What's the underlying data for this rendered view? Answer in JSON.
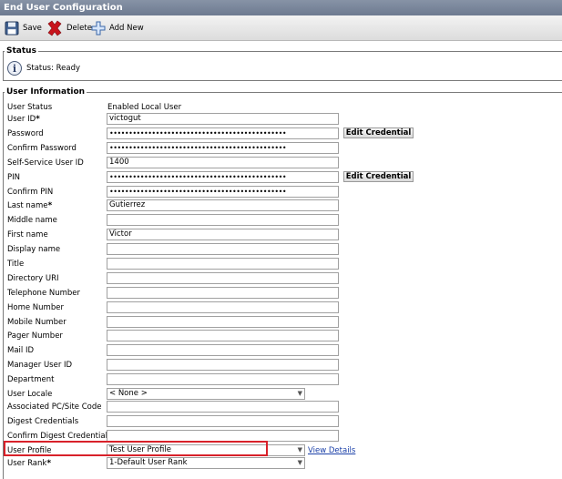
{
  "window": {
    "title": "End User Configuration"
  },
  "toolbar": {
    "save_label": "Save",
    "delete_label": "Delete",
    "add_new_label": "Add New"
  },
  "status": {
    "legend": "Status",
    "text": "Status: Ready"
  },
  "user_info": {
    "legend": "User Information",
    "user_status_label": "User Status",
    "user_status_value": "Enabled Local User",
    "user_id_label": "User ID",
    "user_id_value": "victogut",
    "password_label": "Password",
    "password_value": "••••••••••••••••••••••••••••••••••••••••••••••",
    "edit_credential_label": "Edit Credential",
    "confirm_password_label": "Confirm Password",
    "confirm_password_value": "••••••••••••••••••••••••••••••••••••••••••••••",
    "self_service_label": "Self-Service User ID",
    "self_service_value": "1400",
    "pin_label": "PIN",
    "pin_value": "••••••••••••••••••••••••••••••••••••••••••••••",
    "confirm_pin_label": "Confirm PIN",
    "confirm_pin_value": "••••••••••••••••••••••••••••••••••••••••••••••",
    "last_name_label": "Last name",
    "last_name_value": "Gutierrez",
    "middle_name_label": "Middle name",
    "middle_name_value": "",
    "first_name_label": "First name",
    "first_name_value": "Victor",
    "display_name_label": "Display name",
    "display_name_value": "",
    "title_label": "Title",
    "title_value": "",
    "directory_uri_label": "Directory URI",
    "directory_uri_value": "",
    "telephone_label": "Telephone Number",
    "telephone_value": "",
    "home_number_label": "Home Number",
    "home_number_value": "",
    "mobile_number_label": "Mobile Number",
    "mobile_number_value": "",
    "pager_number_label": "Pager Number",
    "pager_number_value": "",
    "mail_id_label": "Mail ID",
    "mail_id_value": "",
    "manager_user_id_label": "Manager User ID",
    "manager_user_id_value": "",
    "department_label": "Department",
    "department_value": "",
    "user_locale_label": "User Locale",
    "user_locale_value": "< None >",
    "pc_site_code_label": "Associated PC/Site Code",
    "pc_site_code_value": "",
    "digest_label": "Digest Credentials",
    "digest_value": "",
    "confirm_digest_label": "Confirm Digest Credentials",
    "confirm_digest_value": "",
    "user_profile_label": "User Profile",
    "user_profile_value": "Test User Profile",
    "view_details_label": "View Details",
    "user_rank_label": "User Rank",
    "user_rank_value": "1-Default User Rank",
    "required_marker": "*"
  },
  "colors": {
    "titlebar": "#7a869b",
    "highlight": "#d8212a",
    "link": "#1a3fa8"
  }
}
